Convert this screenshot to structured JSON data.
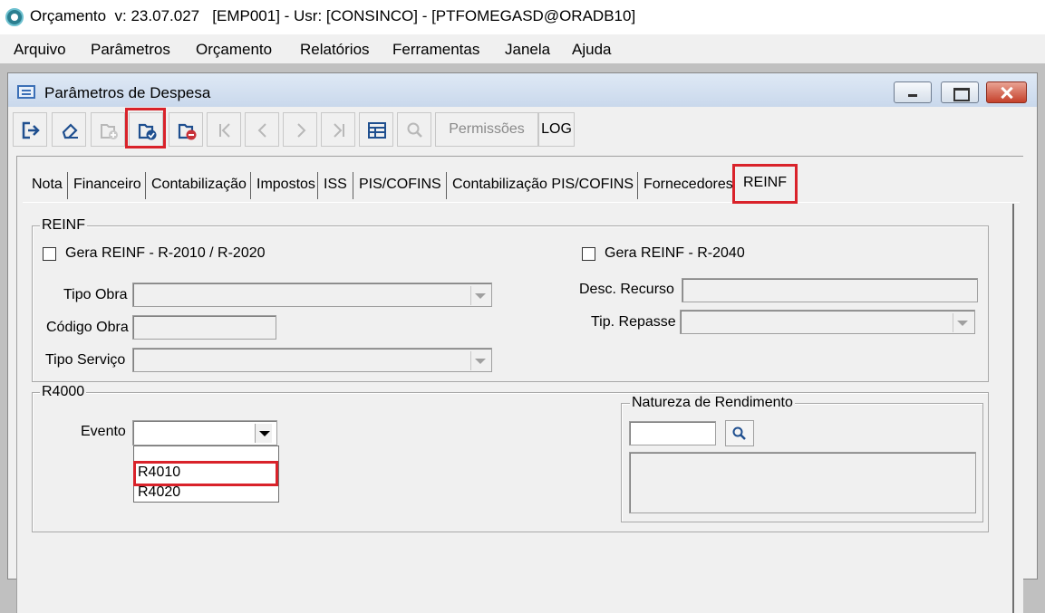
{
  "app": {
    "title": "Orçamento  v: 23.07.027   [EMP001] - Usr: [CONSINCO] - [PTFOMEGASD@ORADB10]"
  },
  "menu": {
    "items": [
      "Arquivo",
      "Parâmetros",
      "Orçamento",
      "Relatórios",
      "Ferramentas",
      "Janela",
      "Ajuda"
    ]
  },
  "window": {
    "title": "Parâmetros de Despesa"
  },
  "toolbar": {
    "buttons": [
      {
        "icon": "exit-icon",
        "enabled": true
      },
      {
        "icon": "eraser-icon",
        "enabled": true
      },
      {
        "icon": "add-folder-icon",
        "enabled": false
      },
      {
        "icon": "save-folder-icon",
        "enabled": true,
        "highlighted": true
      },
      {
        "icon": "delete-folder-icon",
        "enabled": true
      },
      {
        "icon": "first-record-icon",
        "enabled": false
      },
      {
        "icon": "previous-record-icon",
        "enabled": false
      },
      {
        "icon": "next-record-icon",
        "enabled": false
      },
      {
        "icon": "last-record-icon",
        "enabled": false
      },
      {
        "icon": "grid-icon",
        "enabled": true
      },
      {
        "icon": "search-icon",
        "enabled": false
      }
    ],
    "permissions_label": "Permissões",
    "log_label": "LOG"
  },
  "tabs": {
    "items": [
      "Nota",
      "Financeiro",
      "Contabilização",
      "Impostos",
      "ISS",
      "PIS/COFINS",
      "Contabilização PIS/COFINS",
      "Fornecedores"
    ],
    "active": "REINF"
  },
  "reinf": {
    "group_label": "REINF",
    "gera_r2010_label": "Gera REINF - R-2010 / R-2020",
    "gera_r2040_label": "Gera REINF - R-2040",
    "tipo_obra_label": "Tipo Obra",
    "codigo_obra_label": "Código Obra",
    "tipo_servico_label": "Tipo Serviço",
    "desc_recurso_label": "Desc. Recurso",
    "tip_repasse_label": "Tip. Repasse"
  },
  "r4000": {
    "group_label": "R4000",
    "evento_label": "Evento",
    "evento_options": [
      "R4010",
      "R4020"
    ],
    "natureza_label": "Natureza de Rendimento"
  },
  "colors": {
    "highlight": "#d9222a",
    "toolbar_icon": "#1f4f8f",
    "delete_badge": "#c8323a"
  }
}
